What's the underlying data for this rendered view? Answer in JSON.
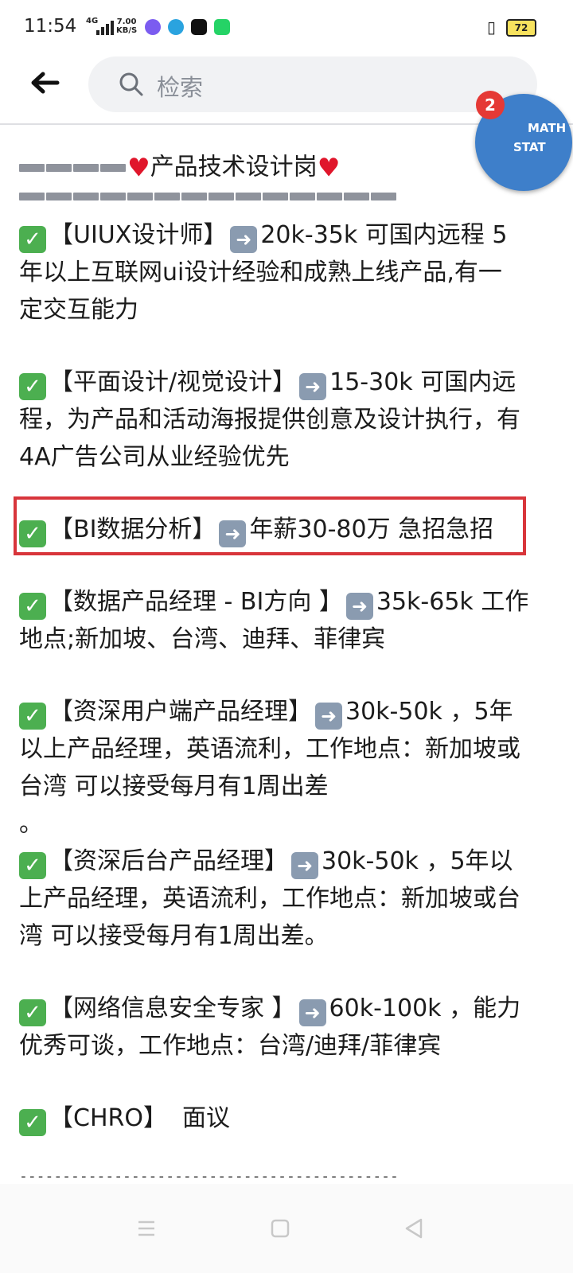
{
  "status_bar": {
    "time": "11:54",
    "network": "4G",
    "speed_value": "7.00",
    "speed_unit": "KB/S",
    "battery": "72",
    "app_icons": [
      "messenger-icon",
      "telegram-icon",
      "tiktok-icon",
      "whatsapp-icon"
    ]
  },
  "header": {
    "search_placeholder": "检索"
  },
  "bubble": {
    "badge_count": "2",
    "line1": "MATH",
    "line2": "STAT"
  },
  "post": {
    "title": "产品技术设计岗",
    "items": [
      {
        "lines": [
          "【UIUX设计师】",
          "20k-35k 可国内远程  5",
          "年以上互联网ui设计经验和成熟上线产品,有一",
          "定交互能力"
        ]
      },
      {
        "lines": [
          "【平面设计/视觉设计】",
          "15-30k 可国内远",
          "程，为产品和活动海报提供创意及设计执行，有",
          "4A广告公司从业经验优先"
        ]
      },
      {
        "lines": [
          "【BI数据分析】",
          "年薪30-80万 急招急招"
        ]
      },
      {
        "lines": [
          "【数据产品经理 - BI方向 】",
          "35k-65k  工作",
          "地点;新加坡、台湾、迪拜、菲律宾"
        ]
      },
      {
        "lines": [
          "【资深用户端产品经理】",
          "30k-50k ，5年",
          "以上产品经理，英语流利，工作地点：新加坡或",
          "台湾 可以接受每月有1周出差",
          "。"
        ]
      },
      {
        "lines": [
          "【资深后台产品经理】",
          "30k-50k ，5年以",
          "上产品经理，英语流利，工作地点：新加坡或台",
          "湾 可以接受每月有1周出差。"
        ]
      },
      {
        "lines": [
          "【网络信息安全专家 】",
          "60k-100k ，能力",
          "优秀可谈，工作地点：台湾/迪拜/菲律宾"
        ]
      },
      {
        "lines": [
          "【CHRO】",
          "面议"
        ]
      }
    ],
    "footer_dashes": "--------------------------------------------"
  },
  "colors": {
    "highlight": "#d8353b",
    "check": "#4caf50",
    "heart": "#e0162b"
  }
}
